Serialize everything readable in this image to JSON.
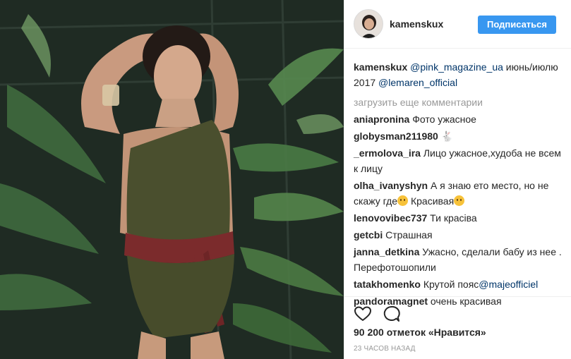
{
  "post": {
    "username": "kamenskux",
    "follow_label": "Подписаться",
    "caption": {
      "username": "kamenskux",
      "mention1": "@pink_magazine_ua",
      "text1": " июнь/июлю 2017 ",
      "mention2": "@lemaren_official"
    },
    "load_more": "загрузить еще комментарии",
    "comments": [
      {
        "user": "aniapronina",
        "text": "Фото ужасное"
      },
      {
        "user": "globysman211980",
        "text": ""
      },
      {
        "user": "_ermolova_ira",
        "text": "Лицо ужасное,худоба не всем к лицу"
      },
      {
        "user": "olha_ivanyshyn",
        "text": "А я знаю ето место, но не скажу где",
        "text2": " Красивая"
      },
      {
        "user": "lenovovibec737",
        "text": "Ти красіва"
      },
      {
        "user": "getcbi",
        "text": "Страшная"
      },
      {
        "user": "janna_detkina",
        "text": "Ужасно, сделали бабу из нее . Перефотошопили"
      },
      {
        "user": "tatakhomenko",
        "text": "Крутой пояс",
        "mention": "@majeofficiel"
      },
      {
        "user": "pandoramagnet",
        "text": "очень красивая"
      }
    ],
    "likes": "90 200 отметок «Нравится»",
    "time": "23 ЧАСОВ НАЗАД"
  },
  "icons": {
    "like": "heart-icon",
    "comment": "comment-bubble-icon",
    "comment_emoji": "rabbit-icon"
  },
  "colors": {
    "follow_button": "#3897f0",
    "mention": "#003569",
    "muted": "#999999"
  }
}
